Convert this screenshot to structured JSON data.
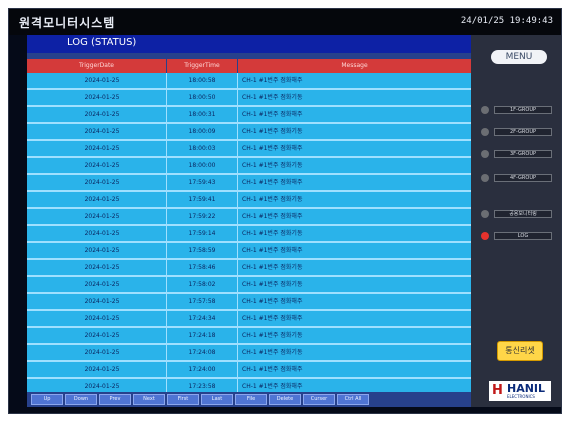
{
  "header": {
    "app_title": "원격모니터시스템",
    "clock": "24/01/25 19:49:43"
  },
  "panel": {
    "title": "LOG (STATUS)"
  },
  "table": {
    "columns": [
      "TriggerDate",
      "TriggerTime",
      "Message"
    ],
    "rows": [
      {
        "date": "2024-01-25",
        "time": "18:00:58",
        "msg": "CH-1 #1번주 점화해주"
      },
      {
        "date": "2024-01-25",
        "time": "18:00:50",
        "msg": "CH-1 #1번주 점화기동"
      },
      {
        "date": "2024-01-25",
        "time": "18:00:31",
        "msg": "CH-1 #1번주 점화해주"
      },
      {
        "date": "2024-01-25",
        "time": "18:00:09",
        "msg": "CH-1 #1번주 점화기동"
      },
      {
        "date": "2024-01-25",
        "time": "18:00:03",
        "msg": "CH-1 #1번주 점화해주"
      },
      {
        "date": "2024-01-25",
        "time": "18:00:00",
        "msg": "CH-1 #1번주 점화기동"
      },
      {
        "date": "2024-01-25",
        "time": "17:59:43",
        "msg": "CH-1 #1번주 점화해주"
      },
      {
        "date": "2024-01-25",
        "time": "17:59:41",
        "msg": "CH-1 #1번주 점화기동"
      },
      {
        "date": "2024-01-25",
        "time": "17:59:22",
        "msg": "CH-1 #1번주 점화해주"
      },
      {
        "date": "2024-01-25",
        "time": "17:59:14",
        "msg": "CH-1 #1번주 점화기동"
      },
      {
        "date": "2024-01-25",
        "time": "17:58:59",
        "msg": "CH-1 #1번주 점화해주"
      },
      {
        "date": "2024-01-25",
        "time": "17:58:46",
        "msg": "CH-1 #1번주 점화기동"
      },
      {
        "date": "2024-01-25",
        "time": "17:58:02",
        "msg": "CH-1 #1번주 점화기동"
      },
      {
        "date": "2024-01-25",
        "time": "17:57:58",
        "msg": "CH-1 #1번주 점화해주"
      },
      {
        "date": "2024-01-25",
        "time": "17:24:34",
        "msg": "CH-1 #1번주 점화해주"
      },
      {
        "date": "2024-01-25",
        "time": "17:24:18",
        "msg": "CH-1 #1번주 점화기동"
      },
      {
        "date": "2024-01-25",
        "time": "17:24:08",
        "msg": "CH-1 #1번주 점화기동"
      },
      {
        "date": "2024-01-25",
        "time": "17:24:00",
        "msg": "CH-1 #1번주 점화해주"
      },
      {
        "date": "2024-01-25",
        "time": "17:23:58",
        "msg": "CH-1 #1번주 점화해주"
      }
    ]
  },
  "nav_buttons": [
    "Up",
    "Down",
    "Prev",
    "Next",
    "First",
    "Last",
    "File",
    "Delete",
    "Curser",
    "Ctrl All"
  ],
  "side": {
    "menu_label": "MENU",
    "items": [
      {
        "label": "1F-GROUP",
        "active": false
      },
      {
        "label": "2F-GROUP",
        "active": false
      },
      {
        "label": "3F-GROUP",
        "active": false
      },
      {
        "label": "4F-GROUP",
        "active": false
      },
      {
        "label": "공용모니터링",
        "active": false
      },
      {
        "label": "LOG",
        "active": true
      }
    ],
    "comm_button": "통신리셋",
    "logo_text": "HANIL",
    "logo_sub": "ELECTRONICS"
  },
  "colors": {
    "header_red": "#d43a3a",
    "row_cyan": "#2ab3ea",
    "panel_blue": "#27418c",
    "active_dot": "#e5322d",
    "comm_yellow": "#ffd648"
  }
}
